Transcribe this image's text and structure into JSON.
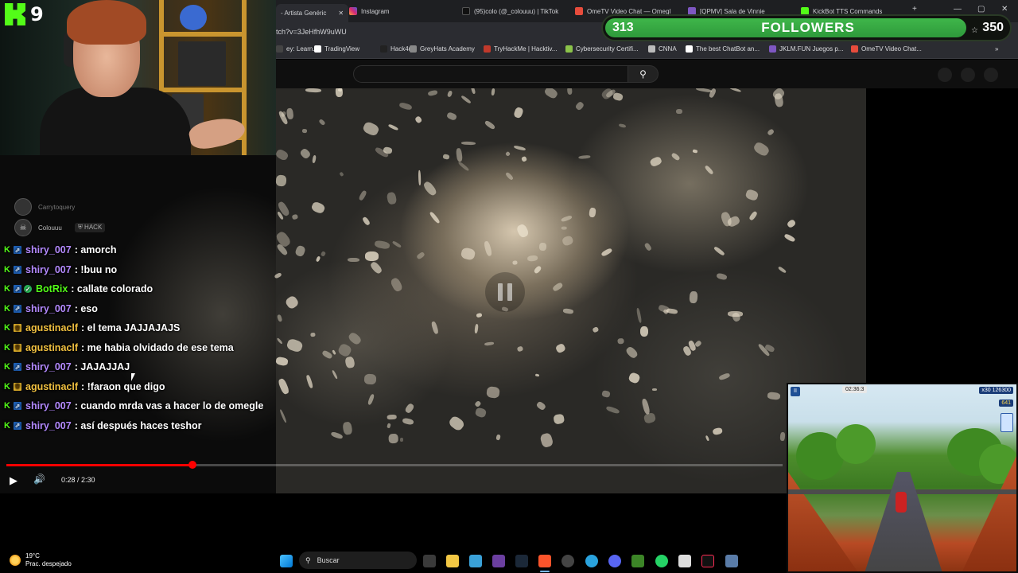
{
  "browser": {
    "tabs": [
      {
        "title": "- Artista Genéric",
        "active": true
      },
      {
        "title": "Instagram"
      },
      {
        "title": "(95)colo (@_colouuu) | TikTok"
      },
      {
        "title": "OmeTV Video Chat — Omegl"
      },
      {
        "title": "[QPMV] Sala de Vinnie"
      },
      {
        "title": "KickBot TTS Commands"
      }
    ],
    "close_tab_glyph": "✕",
    "new_tab_glyph": "+",
    "window_controls": [
      "—",
      "▢",
      "✕"
    ],
    "url": "tch?v=3JeHfhW9uWU",
    "bookmarks": [
      {
        "label": "ey: Learn...",
        "color": "#444444"
      },
      {
        "label": "TradingView",
        "color": "#ffffff"
      },
      {
        "label": "Hack4u",
        "color": "#222222"
      },
      {
        "label": "GreyHats Academy",
        "color": "#888888"
      },
      {
        "label": "TryHackMe | Hacktiv...",
        "color": "#c0392b"
      },
      {
        "label": "Cybersecurity Certifi...",
        "color": "#8bc34a"
      },
      {
        "label": "CNNA",
        "color": "#bbbbbb"
      },
      {
        "label": "The best ChatBot an...",
        "color": "#ffffff"
      },
      {
        "label": "JKLM.FUN Juegos p...",
        "color": "#7e57c2"
      },
      {
        "label": "OmeTV Video Chat...",
        "color": "#e74c3c"
      }
    ],
    "bookmarks_more": "»"
  },
  "youtube": {
    "search_icon": "⚲",
    "time_display": "0:28 / 2:30",
    "progress": 0.24,
    "play_glyph": "▶",
    "volume_glyph": "🔊"
  },
  "overlay": {
    "kick_count": "9",
    "followers": {
      "current": "313",
      "label": "FOLLOWERS",
      "goal": "350",
      "progress": 0.894
    }
  },
  "chat": {
    "top_users": [
      {
        "name": "Carrytoquery"
      },
      {
        "name": "Colouuu",
        "badge": "HACK"
      }
    ],
    "messages": [
      {
        "user": "shiry_007",
        "text": ": amorch",
        "color": "#b48aff",
        "badges": [
          "kick",
          "blue"
        ]
      },
      {
        "user": "shiry_007",
        "text": ": !buu no",
        "color": "#b48aff",
        "badges": [
          "kick",
          "blue"
        ]
      },
      {
        "user": "BotRix",
        "text": ": callate colorado",
        "color": "#53fc18",
        "badges": [
          "kick",
          "blue",
          "check"
        ]
      },
      {
        "user": "shiry_007",
        "text": ": eso",
        "color": "#b48aff",
        "badges": [
          "kick",
          "blue"
        ]
      },
      {
        "user": "agustinaclf",
        "text": ": el tema JAJJAJAJS",
        "color": "#f0c040",
        "badges": [
          "kick",
          "crown"
        ]
      },
      {
        "user": "agustinaclf",
        "text": ": me habia olvidado de ese tema",
        "color": "#f0c040",
        "badges": [
          "kick",
          "crown"
        ]
      },
      {
        "user": "shiry_007",
        "text": ": JAJAJJAJ",
        "color": "#b48aff",
        "badges": [
          "kick",
          "blue"
        ]
      },
      {
        "user": "agustinaclf",
        "text": ": !faraon que digo",
        "color": "#f0c040",
        "badges": [
          "kick",
          "crown"
        ]
      },
      {
        "user": "shiry_007",
        "text": ": cuando mrda vas a hacer lo de omegle",
        "color": "#b48aff",
        "badges": [
          "kick",
          "blue"
        ]
      },
      {
        "user": "shiry_007",
        "text": ": así después haces teshor",
        "color": "#b48aff",
        "badges": [
          "kick",
          "blue"
        ]
      }
    ]
  },
  "game": {
    "timer": "02:36:3",
    "score": "126300",
    "multiplier": "x30",
    "coins": "641"
  },
  "taskbar": {
    "weather_temp": "19°C",
    "weather_desc": "Prac. despejado",
    "search_placeholder": "Buscar"
  }
}
